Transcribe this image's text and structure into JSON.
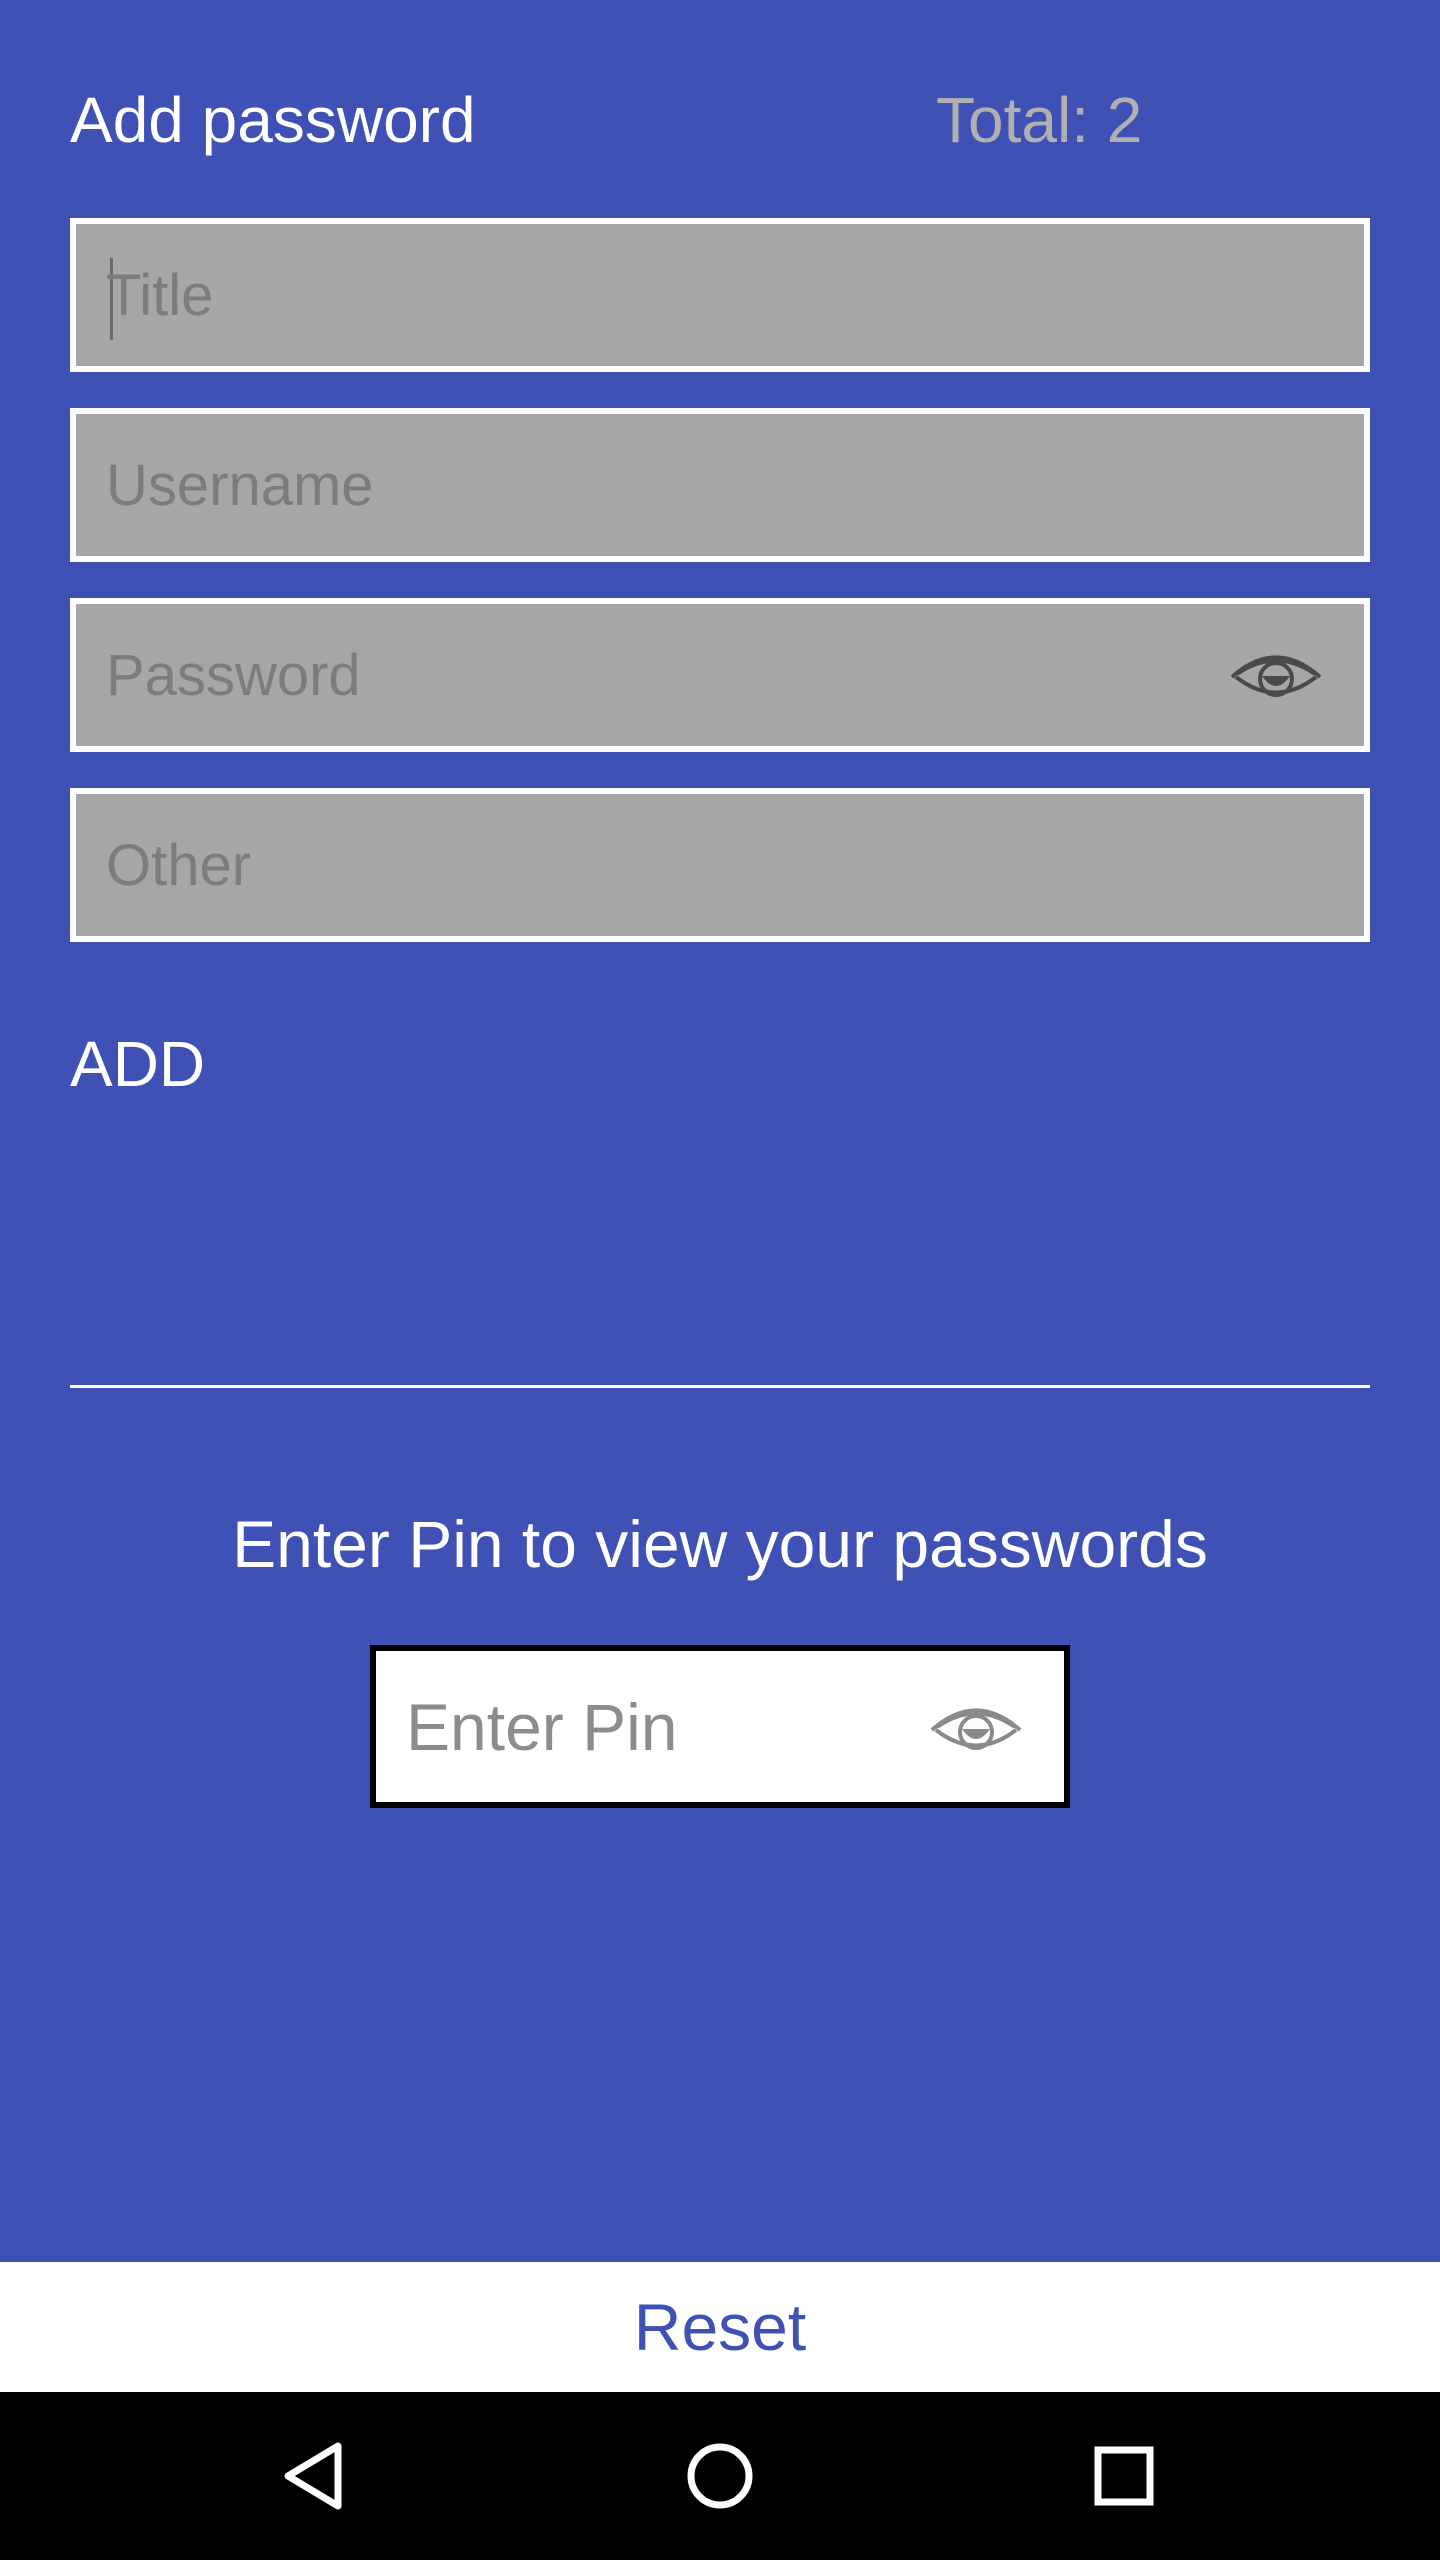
{
  "header": {
    "title": "Add password",
    "total": "Total: 2"
  },
  "form": {
    "title_placeholder": "Title",
    "username_placeholder": "Username",
    "password_placeholder": "Password",
    "other_placeholder": "Other",
    "add_label": "ADD",
    "password_toggle_icon": "eye-icon"
  },
  "pin": {
    "prompt": "Enter Pin to view your passwords",
    "placeholder": "Enter Pin",
    "toggle_icon": "eye-icon"
  },
  "footer": {
    "reset_label": "Reset"
  },
  "navbar": {
    "back_icon": "back-triangle-icon",
    "home_icon": "home-circle-icon",
    "recent_icon": "recents-square-icon"
  },
  "colors": {
    "background": "#3f51b5",
    "field_fill": "#a6a6a6",
    "field_border": "#ffffff",
    "accent_text": "#3f51b5",
    "muted_text": "#b0b0b0"
  }
}
